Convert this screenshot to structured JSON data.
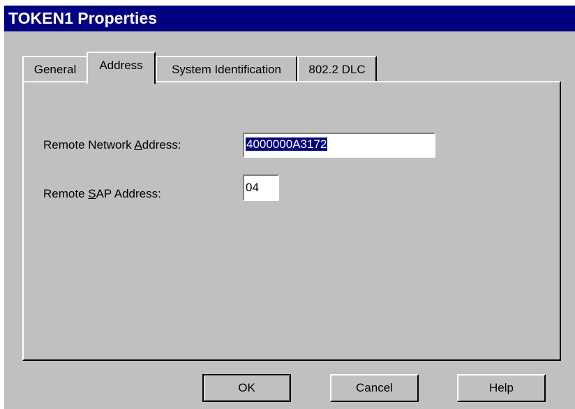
{
  "window": {
    "title": "TOKEN1 Properties"
  },
  "tabs": [
    {
      "label": "General"
    },
    {
      "label": "Address",
      "active": true
    },
    {
      "label": "System Identification"
    },
    {
      "label": "802.2 DLC"
    }
  ],
  "address_tab": {
    "remote_network_address": {
      "label_pre": "Remote Network ",
      "label_key": "A",
      "label_post": "ddress:",
      "value": "4000000A3172"
    },
    "remote_sap_address": {
      "label_pre": "Remote ",
      "label_key": "S",
      "label_post": "AP Address:",
      "value": "04"
    }
  },
  "buttons": {
    "ok": "OK",
    "cancel": "Cancel",
    "help": "Help"
  }
}
